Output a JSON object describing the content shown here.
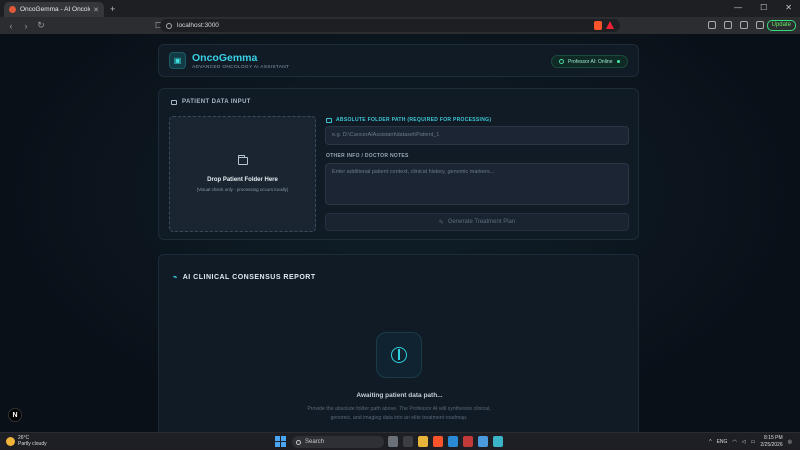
{
  "browser": {
    "tab_title": "OncoGemma - AI Oncology Assi",
    "url": "localhost:3000",
    "update_label": "Update"
  },
  "header": {
    "app_name": "OncoGemma",
    "subtitle": "ADVANCED ONCOLOGY AI ASSISTANT",
    "status": "Professor AI: Online"
  },
  "input_section": {
    "title": "PATIENT DATA INPUT",
    "drop_title": "Drop Patient Folder Here",
    "drop_sub": "(Visual check only - processing occurs locally)",
    "path_label": "ABSOLUTE FOLDER PATH (REQUIRED FOR PROCESSING)",
    "path_placeholder": "e.g. D:\\CancerAIAssistant\\dataset\\Patient_1",
    "notes_label": "OTHER INFO / DOCTOR NOTES",
    "notes_placeholder": "Enter additional patient context, clinical history, genomic markers...",
    "generate_label": "Generate Treatment Plan"
  },
  "report_section": {
    "title": "AI CLINICAL CONSENSUS REPORT",
    "awaiting": "Awaiting patient data path...",
    "awaiting_sub": "Provide the absolute folder path above. The Professor AI will synthesize clinical, genomic, and imaging data into an elite treatment roadmap."
  },
  "taskbar": {
    "temp": "26°C",
    "weather": "Partly cloudy",
    "search": "Search",
    "lang": "ENG",
    "time": "8:15 PM",
    "date": "2/25/2026"
  },
  "dev_badge": "N"
}
